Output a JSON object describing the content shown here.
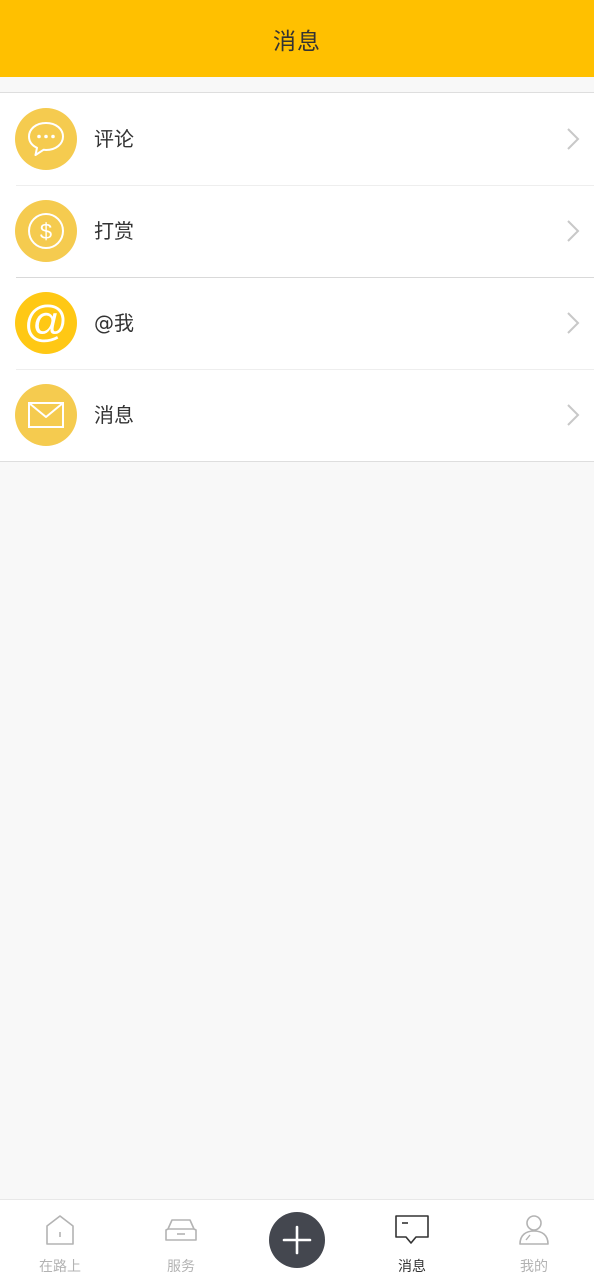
{
  "header": {
    "title": "消息"
  },
  "messages": {
    "items": [
      {
        "label": "评论",
        "icon": "comment-bubble-icon",
        "color": "#f5cb4f"
      },
      {
        "label": "打赏",
        "icon": "dollar-coin-icon",
        "color": "#f5cb4f"
      },
      {
        "label": "@我",
        "icon": "at-sign-icon",
        "color": "#ffc814"
      },
      {
        "label": "消息",
        "icon": "envelope-icon",
        "color": "#f5cb4f"
      }
    ]
  },
  "tabbar": {
    "tabs": [
      {
        "label": "在路上",
        "icon": "house-icon",
        "active": false
      },
      {
        "label": "服务",
        "icon": "car-icon",
        "active": false
      },
      {
        "label": "",
        "icon": "plus-icon",
        "active": false
      },
      {
        "label": "消息",
        "icon": "message-box-icon",
        "active": true
      },
      {
        "label": "我的",
        "icon": "person-icon",
        "active": false
      }
    ]
  },
  "colors": {
    "header_bg": "#ffc000",
    "page_bg": "#f8f8f8",
    "active_tab": "#333333",
    "inactive_tab": "#b3b3b3",
    "add_button": "#44474f"
  }
}
